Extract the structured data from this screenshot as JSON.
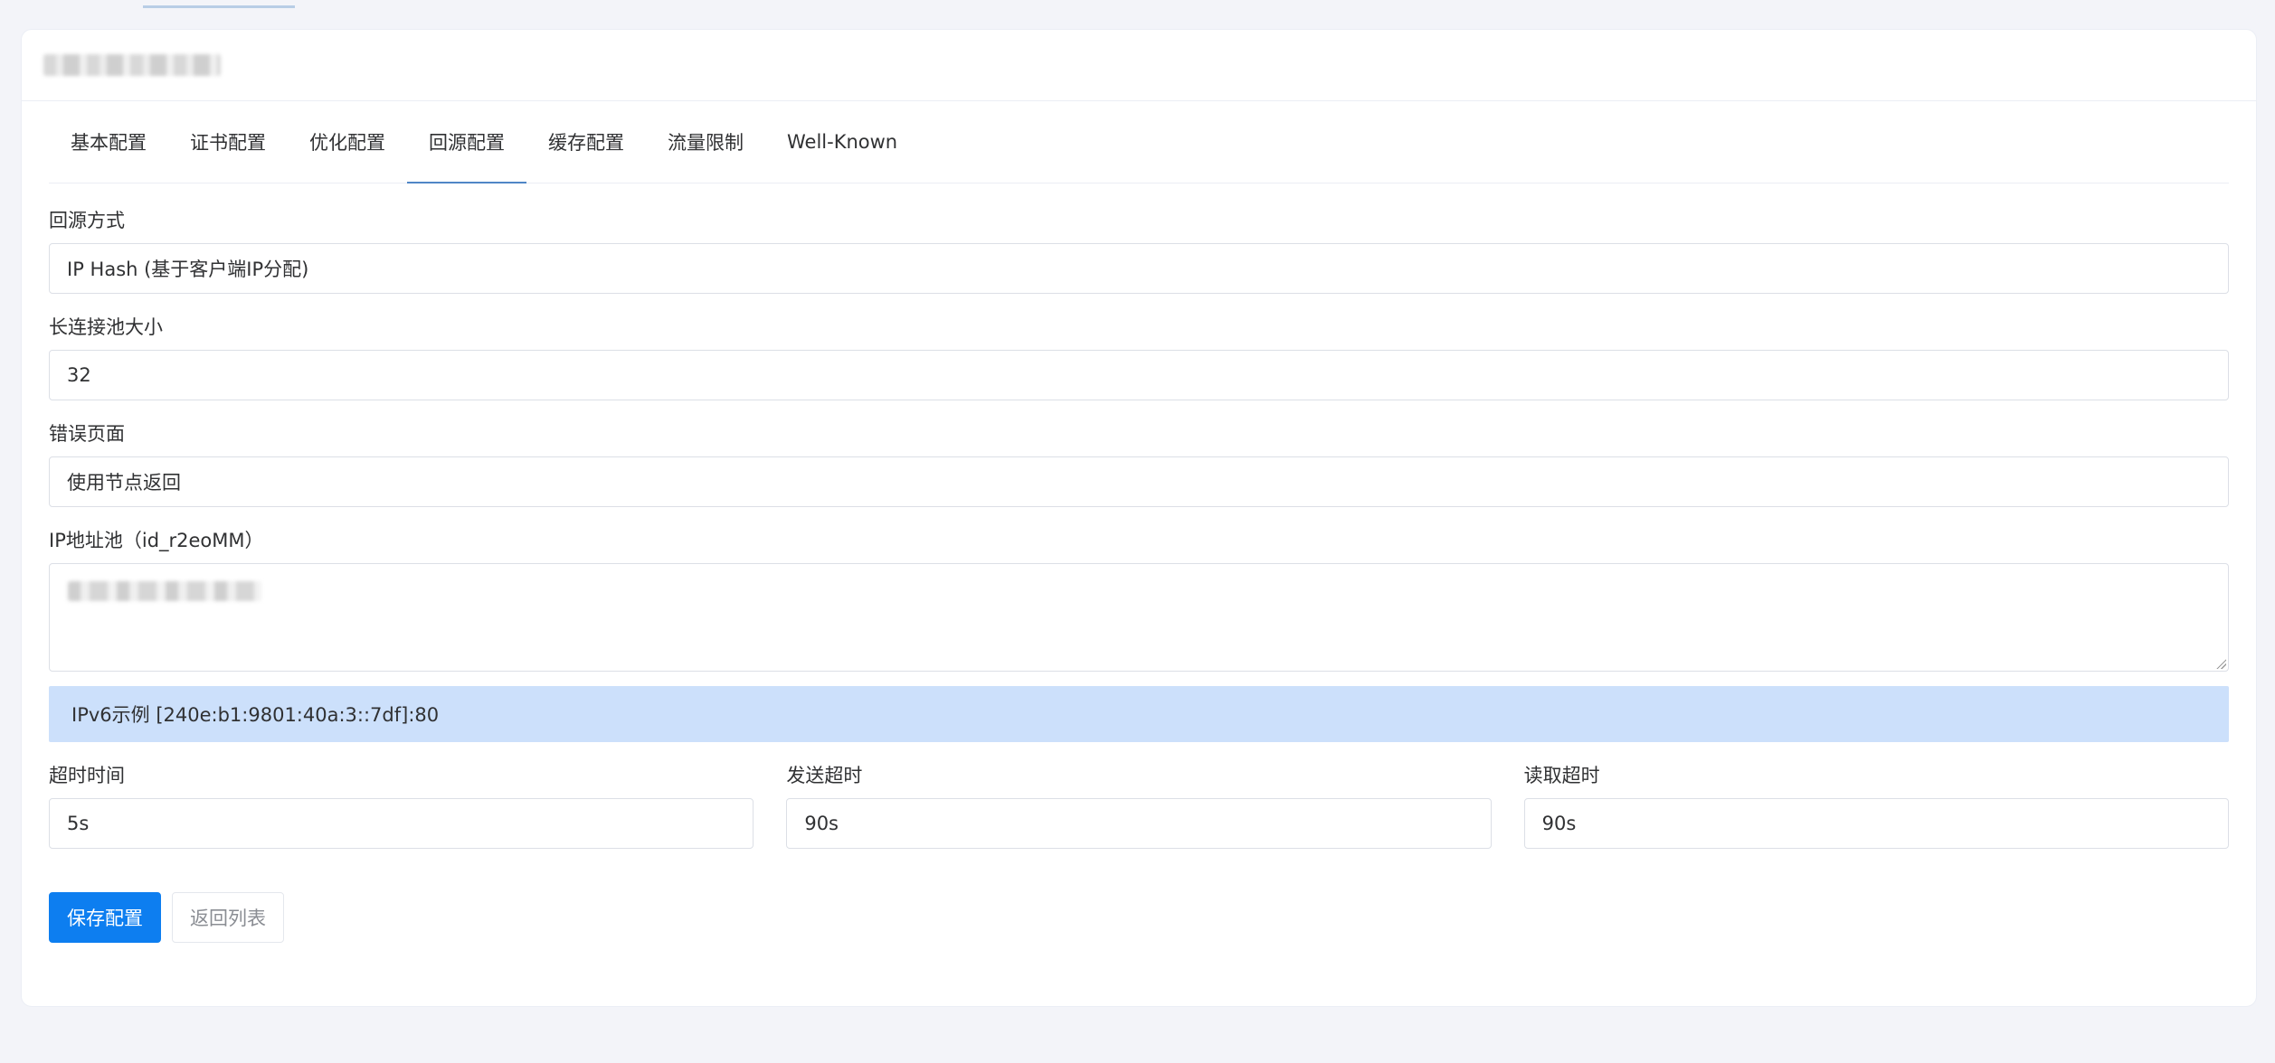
{
  "tabs": [
    {
      "label": "基本配置"
    },
    {
      "label": "证书配置"
    },
    {
      "label": "优化配置"
    },
    {
      "label": "回源配置",
      "active": true
    },
    {
      "label": "缓存配置"
    },
    {
      "label": "流量限制"
    },
    {
      "label": "Well-Known"
    }
  ],
  "form": {
    "origin_method": {
      "label": "回源方式",
      "value": "IP Hash (基于客户端IP分配)"
    },
    "keepalive_pool": {
      "label": "长连接池大小",
      "value": "32"
    },
    "error_page": {
      "label": "错误页面",
      "value": "使用节点返回"
    },
    "ip_pool": {
      "label": "IP地址池（id_r2eoMM）"
    },
    "ipv6_hint": "IPv6示例 [240e:b1:9801:40a:3::7df]:80",
    "timeout": {
      "label": "超时时间",
      "value": "5s"
    },
    "send_timeout": {
      "label": "发送超时",
      "value": "90s"
    },
    "read_timeout": {
      "label": "读取超时",
      "value": "90s"
    }
  },
  "actions": {
    "save_label": "保存配置",
    "back_label": "返回列表"
  },
  "colors": {
    "primary": "#0d7ef0",
    "info_bg": "#cce0fb",
    "active_tab_underline": "#4f86c6"
  }
}
